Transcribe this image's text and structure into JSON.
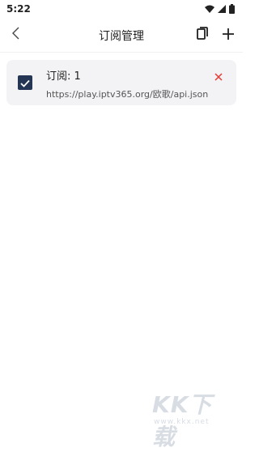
{
  "status_bar": {
    "time": "5:22"
  },
  "toolbar": {
    "title": "订阅管理"
  },
  "subscriptions": [
    {
      "name": "订阅: 1",
      "url": "https://play.iptv365.org/欧歌/api.json",
      "checked": true
    }
  ],
  "watermark": {
    "text": "KK下载",
    "url": "www.kkx.net"
  },
  "colors": {
    "checkbox": "#243653",
    "delete": "#e53935",
    "card_bg": "#f3f3f5"
  }
}
